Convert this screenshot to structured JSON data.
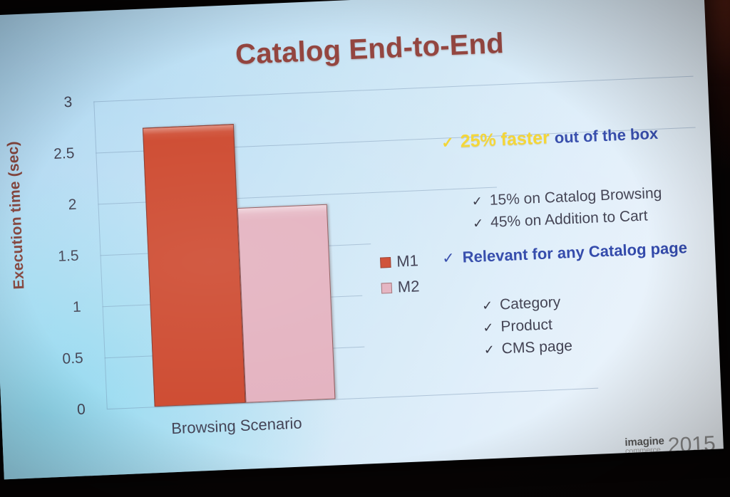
{
  "slide": {
    "title": "Catalog End-to-End",
    "accent_title_color": "#8d3a34",
    "accent_blue": "#2c44a8",
    "accent_yellow": "#f4d42b",
    "background_color": "#bcdff4"
  },
  "chart_data": {
    "type": "bar",
    "title": "Catalog End-to-End",
    "xlabel": "Browsing Scenario",
    "ylabel": "Execution time (sec)",
    "categories": [
      "Browsing Scenario"
    ],
    "ylim": [
      0,
      3
    ],
    "yticks": [
      "0",
      "0.5",
      "1",
      "1.5",
      "2",
      "2.5",
      "3"
    ],
    "grid": true,
    "legend_position": "right",
    "series": [
      {
        "name": "M1",
        "values": [
          2.72
        ],
        "color": "#cc4429"
      },
      {
        "name": "M2",
        "values": [
          1.9
        ],
        "color": "#e3b0be"
      }
    ]
  },
  "legend": {
    "items": [
      {
        "label": "M1",
        "color": "#cc4429"
      },
      {
        "label": "M2",
        "color": "#e3b0be"
      }
    ]
  },
  "content": {
    "headline": {
      "check": "✓",
      "strong": "25% faster",
      "rest": "out of the box"
    },
    "headline_bullets": [
      {
        "check": "✓",
        "text": "15% on Catalog Browsing"
      },
      {
        "check": "✓",
        "text": "45% on Addition to Cart"
      }
    ],
    "relevant": {
      "check": "✓",
      "text": "Relevant for any Catalog page"
    },
    "relevant_bullets": [
      {
        "check": "✓",
        "text": "Category"
      },
      {
        "check": "✓",
        "text": "Product"
      },
      {
        "check": "✓",
        "text": "CMS page"
      }
    ]
  },
  "footer": {
    "logo_primary": "imagine",
    "logo_secondary": "commerce",
    "logo_year": "2015"
  }
}
